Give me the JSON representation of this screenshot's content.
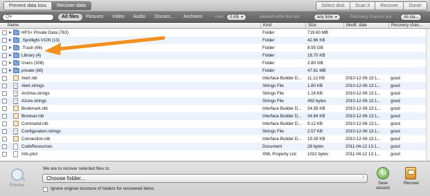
{
  "top_tabs": [
    "Prevent data loss",
    "Recover data"
  ],
  "steps": [
    "Select disk",
    "Scan it",
    "Recover",
    "Done!"
  ],
  "filter": {
    "search_placeholder": "Q▾",
    "tabs": [
      "All files",
      "Pictures",
      "Video",
      "Audio",
      "Docum...",
      "Archives"
    ],
    "over_label": "over",
    "size_value": "0 KB",
    "deleted_label": "deleted within the last",
    "time_value": "any time",
    "chances_label": "Recovery chances are",
    "chances_value": "All sta..."
  },
  "columns": {
    "name": "Name",
    "kind": "Kind",
    "size": "Size",
    "modified": "Modif. date",
    "chance": "Recovery chan..."
  },
  "rows": [
    {
      "type": "folder",
      "name": "HFS+ Private Data (763)",
      "kind": "Folder",
      "size": "719.60 MB",
      "date": "",
      "chance": ""
    },
    {
      "type": "folder",
      "name": ".Spotlight-V100 (13)",
      "kind": "Folder",
      "size": "42.66 KB",
      "date": "",
      "chance": ""
    },
    {
      "type": "folder",
      "name": ".Trash (66)",
      "kind": "Folder",
      "size": "8.95 GB",
      "date": "",
      "chance": ""
    },
    {
      "type": "folder",
      "name": "Library (4)",
      "kind": "Folder",
      "size": "18.70 KB",
      "date": "",
      "chance": ""
    },
    {
      "type": "folder",
      "name": "Users (308)",
      "kind": "Folder",
      "size": "2.80 GB",
      "date": "",
      "chance": ""
    },
    {
      "type": "folder",
      "name": "private (68)",
      "kind": "Folder",
      "size": "47.61 MB",
      "date": "",
      "chance": ""
    },
    {
      "type": "nib",
      "name": "Alert.nib",
      "kind": "Interface Builder D...",
      "size": "11.12 KB",
      "date": "2010-12-06 13:1...",
      "chance": "good"
    },
    {
      "type": "str",
      "name": "Alert.strings",
      "kind": "Strings File",
      "size": "1.80 KB",
      "date": "2010-12-06 13:1...",
      "chance": "good"
    },
    {
      "type": "str",
      "name": "Archive.strings",
      "kind": "Strings File",
      "size": "1.16 KB",
      "date": "2010-12-06 13:1...",
      "chance": "good"
    },
    {
      "type": "str",
      "name": "Azure.strings",
      "kind": "Strings File",
      "size": "492 bytes",
      "date": "2010-12-06 13:1...",
      "chance": "good"
    },
    {
      "type": "nib",
      "name": "Bookmark.nib",
      "kind": "Interface Builder D...",
      "size": "24.58 KB",
      "date": "2010-12-06 13:1...",
      "chance": "good"
    },
    {
      "type": "nib",
      "name": "Browser.nib",
      "kind": "Interface Builder D...",
      "size": "34.64 KB",
      "date": "2010-12-06 13:1...",
      "chance": "good"
    },
    {
      "type": "nib",
      "name": "Command.nib",
      "kind": "Interface Builder D...",
      "size": "9.12 KB",
      "date": "2010-12-06 13:1...",
      "chance": "good"
    },
    {
      "type": "str",
      "name": "Configuration.strings",
      "kind": "Strings File",
      "size": "2.57 KB",
      "date": "2010-12-06 13:1...",
      "chance": "good"
    },
    {
      "type": "nib",
      "name": "Connection.nib",
      "kind": "Interface Builder D...",
      "size": "19.28 KB",
      "date": "2010-12-06 13:1...",
      "chance": "good"
    },
    {
      "type": "doc",
      "name": "CodeResources",
      "kind": "Document",
      "size": "28 bytes",
      "date": "2011-04-12 13:1...",
      "chance": "good"
    },
    {
      "type": "doc",
      "name": "Info.plist",
      "kind": "XML Property List",
      "size": "1022 bytes",
      "date": "2011-04-12 13:1...",
      "chance": "good"
    }
  ],
  "bottom": {
    "preview_label": "Preview",
    "dest_label": "We are to recover selected files to:",
    "folder_select": "Choose folder...",
    "select_arrow": "↕",
    "ignore_label": "Ignore original structure of folders for recovered items",
    "save_label": "Save session",
    "recover_label": "Recover"
  },
  "colors": {
    "annotation_arrow": "#f0901e"
  }
}
